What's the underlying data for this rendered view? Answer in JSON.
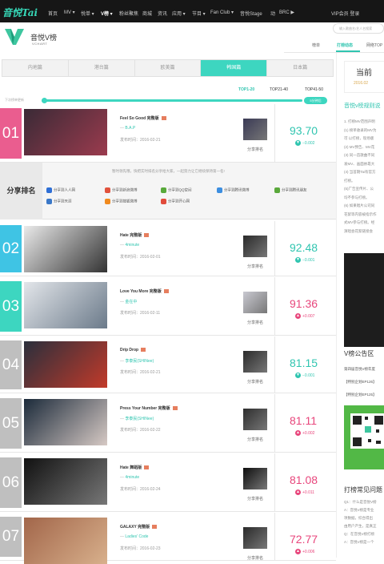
{
  "header": {
    "logo": "音悦Tai",
    "nav": [
      "首页",
      "MV ▾",
      "悦单 ▾",
      "V榜 ▾",
      "粉丝聚焦",
      "商城",
      "资讯",
      "应用 ▾",
      "节目 ▾",
      "Fan Club ▾",
      "音悦Stage",
      "动",
      "BRC ▶"
    ],
    "active_nav": "V榜 ▾",
    "user": "VIP会员  登录"
  },
  "brand": {
    "title": "音悦V榜",
    "subtitle": "VCHART"
  },
  "search": {
    "placeholder": "输入歌曲名/艺人名搜索"
  },
  "subnav": [
    "榜单",
    "打榜动态",
    "网络TOP"
  ],
  "region_tabs": [
    "内地篇",
    "港台篇",
    "欧美篇",
    "韩国篇",
    "日本篇"
  ],
  "active_region": "韩国篇",
  "ranges": [
    "TOP1-20",
    "TOP21-40",
    "TOP41-50"
  ],
  "update_note": "下次榜单更新",
  "timeline_label": "5分钟后",
  "share_panel": {
    "title": "分享排名",
    "tip": "暂时领先哦，快把实时排名分享给大家，一起努力让它继续保持第一名!",
    "items": [
      {
        "label": "分享到人人网",
        "color": "#2f6fd6"
      },
      {
        "label": "分享到新浪微博",
        "color": "#e1523d"
      },
      {
        "label": "分享到QQ空间",
        "color": "#58a93a"
      },
      {
        "label": "分享到腾讯微博",
        "color": "#3c8ee0"
      },
      {
        "label": "分享到腾讯朋友",
        "color": "#5aa83b"
      },
      {
        "label": "分享到天涯",
        "color": "#3a78c8"
      },
      {
        "label": "分享到搜狐微博",
        "color": "#f08a1e"
      },
      {
        "label": "分享到开心网",
        "color": "#e14b3b"
      }
    ]
  },
  "rows": [
    {
      "rank": "01",
      "title": "Feel So Good 完整版",
      "artist": "B.A.P",
      "date": "发布时间：2016-02-21",
      "score": "93.70",
      "delta": "0.002",
      "direction": "down",
      "share": "分享排名",
      "color": "#ea5d8f"
    },
    {
      "rank": "02",
      "title": "Hate 完整版",
      "artist": "4minute",
      "date": "发布时间：2016-02-01",
      "score": "92.48",
      "delta": "0.001",
      "direction": "down",
      "share": "分享排名",
      "color": "#3fc4e4"
    },
    {
      "rank": "03",
      "title": "Love You More 完整版",
      "artist": "金在中",
      "date": "发布时间：2016-02-11",
      "score": "91.36",
      "delta": "0.007",
      "direction": "up",
      "share": "分享排名",
      "color": "#3dd6c0"
    },
    {
      "rank": "04",
      "title": "Drip Drop",
      "artist": "李泰民(SHINee)",
      "date": "发布时间：2016-02-21",
      "score": "81.15",
      "delta": "0.001",
      "direction": "down",
      "share": "分享排名",
      "color": "#bfbfbf"
    },
    {
      "rank": "05",
      "title": "Press Your Number 完整版",
      "artist": "李泰民(SHINee)",
      "date": "发布时间：2016-02-22",
      "score": "81.11",
      "delta": "0.002",
      "direction": "up",
      "share": "分享排名",
      "color": "#bfbfbf"
    },
    {
      "rank": "06",
      "title": "Hate 舞蹈版",
      "artist": "4minute",
      "date": "发布时间：2016-02-24",
      "score": "81.08",
      "delta": "0.011",
      "direction": "up",
      "share": "分享排名",
      "color": "#bfbfbf"
    },
    {
      "rank": "07",
      "title": "GALAXY 完整版",
      "artist": "Ladies' Code",
      "date": "发布时间：2016-02-23",
      "score": "72.77",
      "delta": "0.006",
      "direction": "up",
      "share": "分享排名",
      "color": "#bfbfbf"
    }
  ],
  "sidebar": {
    "current_title": "当前",
    "current_date": "2016.02",
    "rule_title": "音悦v榜规则说",
    "rule_lines": [
      "1. 打榜MV范围声明",
      "(1) 榜单收录的MV为",
      "可 以打榜，现场版",
      "(2) MV预告、MV花",
      "(3) 同一首歌曲不同",
      "发MV、画面依靠大",
      "(4) 当首期Tai有官方",
      "打榜。",
      "(5)广告宣传片、公",
      "均不参与打榜。",
      "(6) 如果唱片公司同",
      "花絮等内容被指示作",
      "式MV参与打榜。经",
      "演唱会花絮链接会"
    ],
    "notice_title": "V榜公告区",
    "notices": [
      "第四届音悦V榜年度",
      "【特别企划EP126】",
      "【特别企划EP125】"
    ],
    "faq_title": "打榜常见问题",
    "faq_lines": [
      "Q1：什么是音悦V榜",
      "A：音悦V榜是专业",
      "项数据，综合得出",
      "由用户产生，是真正",
      "Q：在音悦V榜打榜",
      "A：音悦V榜是一个"
    ]
  }
}
